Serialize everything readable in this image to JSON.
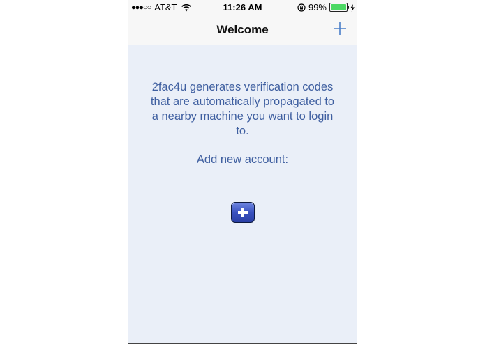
{
  "status_bar": {
    "signal_dots": "●●●○○",
    "carrier": "AT&T",
    "time": "11:26 AM",
    "battery_percent": "99%",
    "battery_level": 0.99,
    "battery_color": "#4cd964"
  },
  "nav": {
    "title": "Welcome"
  },
  "content": {
    "description": "2fac4u generates verification codes that are automatically propagated to a nearby machine you want to login to.",
    "add_label": "Add new account:"
  },
  "colors": {
    "accent": "#3f5fa0",
    "nav_plus": "#4a7ec9",
    "background": "#eaeff8"
  }
}
